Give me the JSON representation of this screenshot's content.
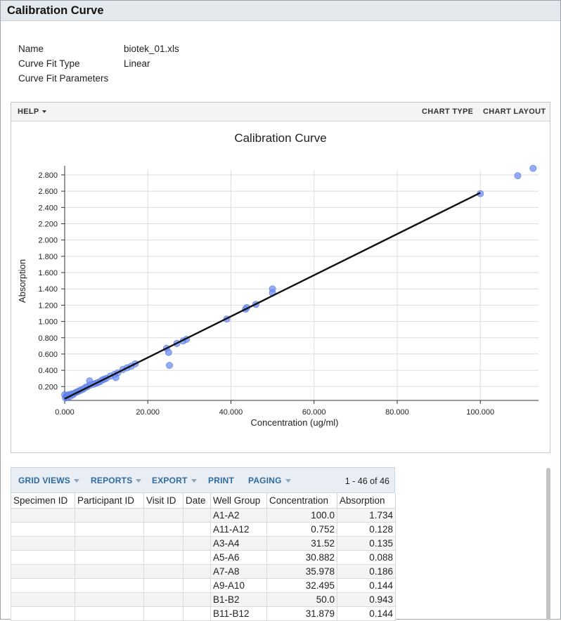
{
  "window": {
    "title": "Calibration Curve"
  },
  "info": [
    {
      "label": "Name",
      "value": "biotek_01.xls"
    },
    {
      "label": "Curve Fit Type",
      "value": "Linear"
    },
    {
      "label": "Curve Fit Parameters",
      "value": ""
    }
  ],
  "chart_toolbar": {
    "help_label": "HELP",
    "chart_type_label": "CHART TYPE",
    "chart_layout_label": "CHART LAYOUT"
  },
  "chart_data": {
    "type": "scatter",
    "title": "Calibration Curve",
    "xlabel": "Concentration (ug/ml)",
    "ylabel": "Absorption",
    "xlim": [
      0,
      114
    ],
    "ylim": [
      0.03,
      2.86
    ],
    "x_ticks": [
      0,
      20,
      40,
      60,
      80,
      100
    ],
    "x_tick_labels": [
      "0.000",
      "20.000",
      "40.000",
      "60.000",
      "80.000",
      "100.000"
    ],
    "y_ticks": [
      0.2,
      0.4,
      0.6,
      0.8,
      1.0,
      1.2,
      1.4,
      1.6,
      1.8,
      2.0,
      2.2,
      2.4,
      2.6,
      2.8
    ],
    "y_tick_labels": [
      "0.200",
      "0.400",
      "0.600",
      "0.800",
      "1.000",
      "1.200",
      "1.400",
      "1.600",
      "1.800",
      "2.000",
      "2.200",
      "2.400",
      "2.600",
      "2.800"
    ],
    "grid": true,
    "point_color": "#6b8cf2",
    "line_color": "#111111",
    "fit_line": {
      "x": [
        0,
        100
      ],
      "y": [
        0.05,
        2.58
      ]
    },
    "points": [
      [
        0.0,
        0.1
      ],
      [
        0.2,
        0.06
      ],
      [
        0.4,
        0.08
      ],
      [
        0.6,
        0.07
      ],
      [
        0.8,
        0.09
      ],
      [
        1.0,
        0.1
      ],
      [
        1.3,
        0.08
      ],
      [
        1.6,
        0.11
      ],
      [
        2.0,
        0.1
      ],
      [
        2.4,
        0.12
      ],
      [
        2.8,
        0.13
      ],
      [
        3.2,
        0.14
      ],
      [
        3.6,
        0.15
      ],
      [
        4.0,
        0.16
      ],
      [
        4.5,
        0.17
      ],
      [
        5.0,
        0.19
      ],
      [
        5.5,
        0.2
      ],
      [
        6.0,
        0.27
      ],
      [
        6.2,
        0.22
      ],
      [
        7.0,
        0.23
      ],
      [
        7.5,
        0.24
      ],
      [
        8.0,
        0.25
      ],
      [
        8.5,
        0.26
      ],
      [
        9.0,
        0.28
      ],
      [
        9.5,
        0.29
      ],
      [
        10.0,
        0.3
      ],
      [
        11.0,
        0.33
      ],
      [
        12.0,
        0.35
      ],
      [
        12.3,
        0.31
      ],
      [
        12.8,
        0.37
      ],
      [
        14.0,
        0.41
      ],
      [
        15.0,
        0.43
      ],
      [
        16.0,
        0.45
      ],
      [
        17.0,
        0.48
      ],
      [
        24.5,
        0.67
      ],
      [
        25.0,
        0.62
      ],
      [
        25.2,
        0.46
      ],
      [
        27.0,
        0.73
      ],
      [
        28.5,
        0.76
      ],
      [
        29.3,
        0.78
      ],
      [
        39.0,
        1.03
      ],
      [
        43.5,
        1.15
      ],
      [
        43.8,
        1.17
      ],
      [
        46.0,
        1.21
      ],
      [
        50.0,
        1.4
      ],
      [
        50.0,
        1.35
      ],
      [
        100.0,
        2.57
      ],
      [
        109.0,
        2.79
      ],
      [
        112.7,
        2.88
      ]
    ]
  },
  "grid_toolbar": {
    "buttons": [
      {
        "label": "GRID VIEWS",
        "dropdown": true
      },
      {
        "label": "REPORTS",
        "dropdown": true
      },
      {
        "label": "EXPORT",
        "dropdown": true
      },
      {
        "label": "PRINT",
        "dropdown": false
      },
      {
        "label": "PAGING",
        "dropdown": true
      }
    ],
    "count": "1 - 46 of 46"
  },
  "table": {
    "columns": [
      "Specimen ID",
      "Participant ID",
      "Visit ID",
      "Date",
      "Well Group",
      "Concentration",
      "Absorption"
    ],
    "rows": [
      [
        "",
        "",
        "",
        "",
        "A1-A2",
        "100.0",
        "1.734"
      ],
      [
        "",
        "",
        "",
        "",
        "A11-A12",
        "0.752",
        "0.128"
      ],
      [
        "",
        "",
        "",
        "",
        "A3-A4",
        "31.52",
        "0.135"
      ],
      [
        "",
        "",
        "",
        "",
        "A5-A6",
        "30.882",
        "0.088"
      ],
      [
        "",
        "",
        "",
        "",
        "A7-A8",
        "35.978",
        "0.186"
      ],
      [
        "",
        "",
        "",
        "",
        "A9-A10",
        "32.495",
        "0.144"
      ],
      [
        "",
        "",
        "",
        "",
        "B1-B2",
        "50.0",
        "0.943"
      ],
      [
        "",
        "",
        "",
        "",
        "B11-B12",
        "31.879",
        "0.144"
      ]
    ]
  }
}
